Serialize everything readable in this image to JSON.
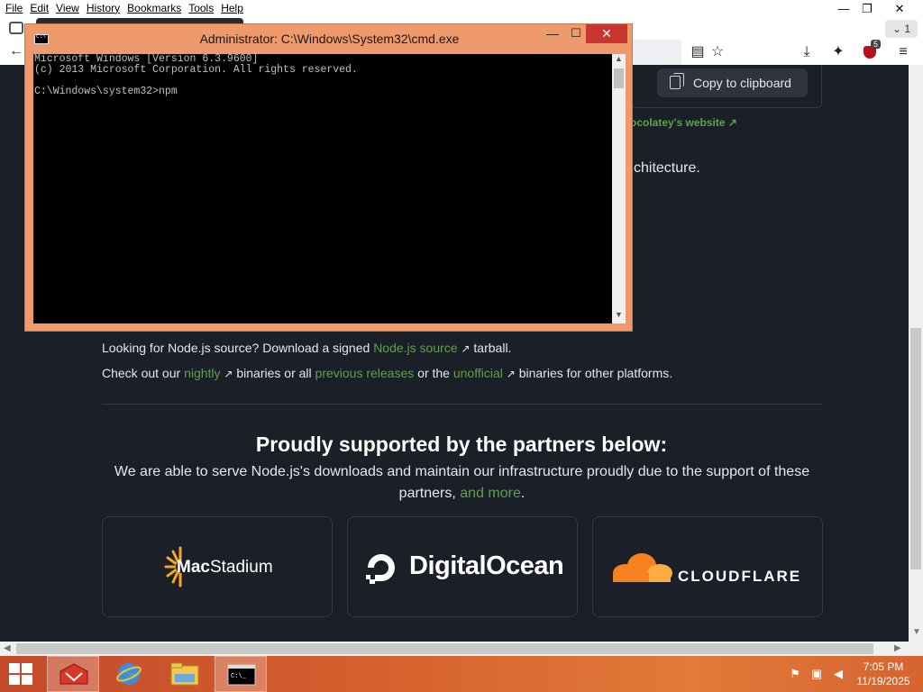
{
  "browser": {
    "menu": [
      {
        "label": "File"
      },
      {
        "label": "Edit"
      },
      {
        "label": "View"
      },
      {
        "label": "History"
      },
      {
        "label": "Bookmarks"
      },
      {
        "label": "Tools"
      },
      {
        "label": "Help"
      }
    ],
    "tab_count": "1",
    "extension_badge": "5",
    "window_controls": {
      "minimize": "—",
      "restore": "❐",
      "close": "✕"
    }
  },
  "page": {
    "copy_button": "Copy to clipboard",
    "chocolatey_link": "ocolatey's website",
    "arch_text": "chitecture.",
    "source_line": {
      "prefix": "Looking for Node.js source? Download a signed ",
      "link": "Node.js source",
      "suffix": " tarball."
    },
    "binaries_line": {
      "p1": "Check out our ",
      "nightly": "nightly",
      "p2": " binaries or all ",
      "previous": "previous releases",
      "p3": " or the ",
      "unofficial": "unofficial",
      "p4": " binaries for other platforms."
    },
    "arrow_glyph": "↗",
    "partners": {
      "title": "Proudly supported by the partners below:",
      "desc": "We are able to serve Node.js's downloads and maintain our infrastructure proudly due to the support of these partners, ",
      "more_link": "and more",
      "period": ".",
      "logos": {
        "macstadium": {
          "mac": "Mac",
          "stadium": "Stadium"
        },
        "digitalocean": "DigitalOcean",
        "cloudflare": "CLOUDFLARE"
      }
    }
  },
  "cmd": {
    "title": "Administrator: C:\\Windows\\System32\\cmd.exe",
    "lines": [
      "Microsoft Windows [Version 6.3.9600]",
      "(c) 2013 Microsoft Corporation. All rights reserved.",
      "",
      "C:\\Windows\\system32>npm"
    ]
  },
  "taskbar": {
    "time": "7:05 PM",
    "date": "11/19/2025"
  },
  "colors": {
    "accent_green": "#5fa04e",
    "page_bg": "#1b1f27",
    "cmd_frame": "#ef9a6c",
    "taskbar": "#d6602e"
  }
}
